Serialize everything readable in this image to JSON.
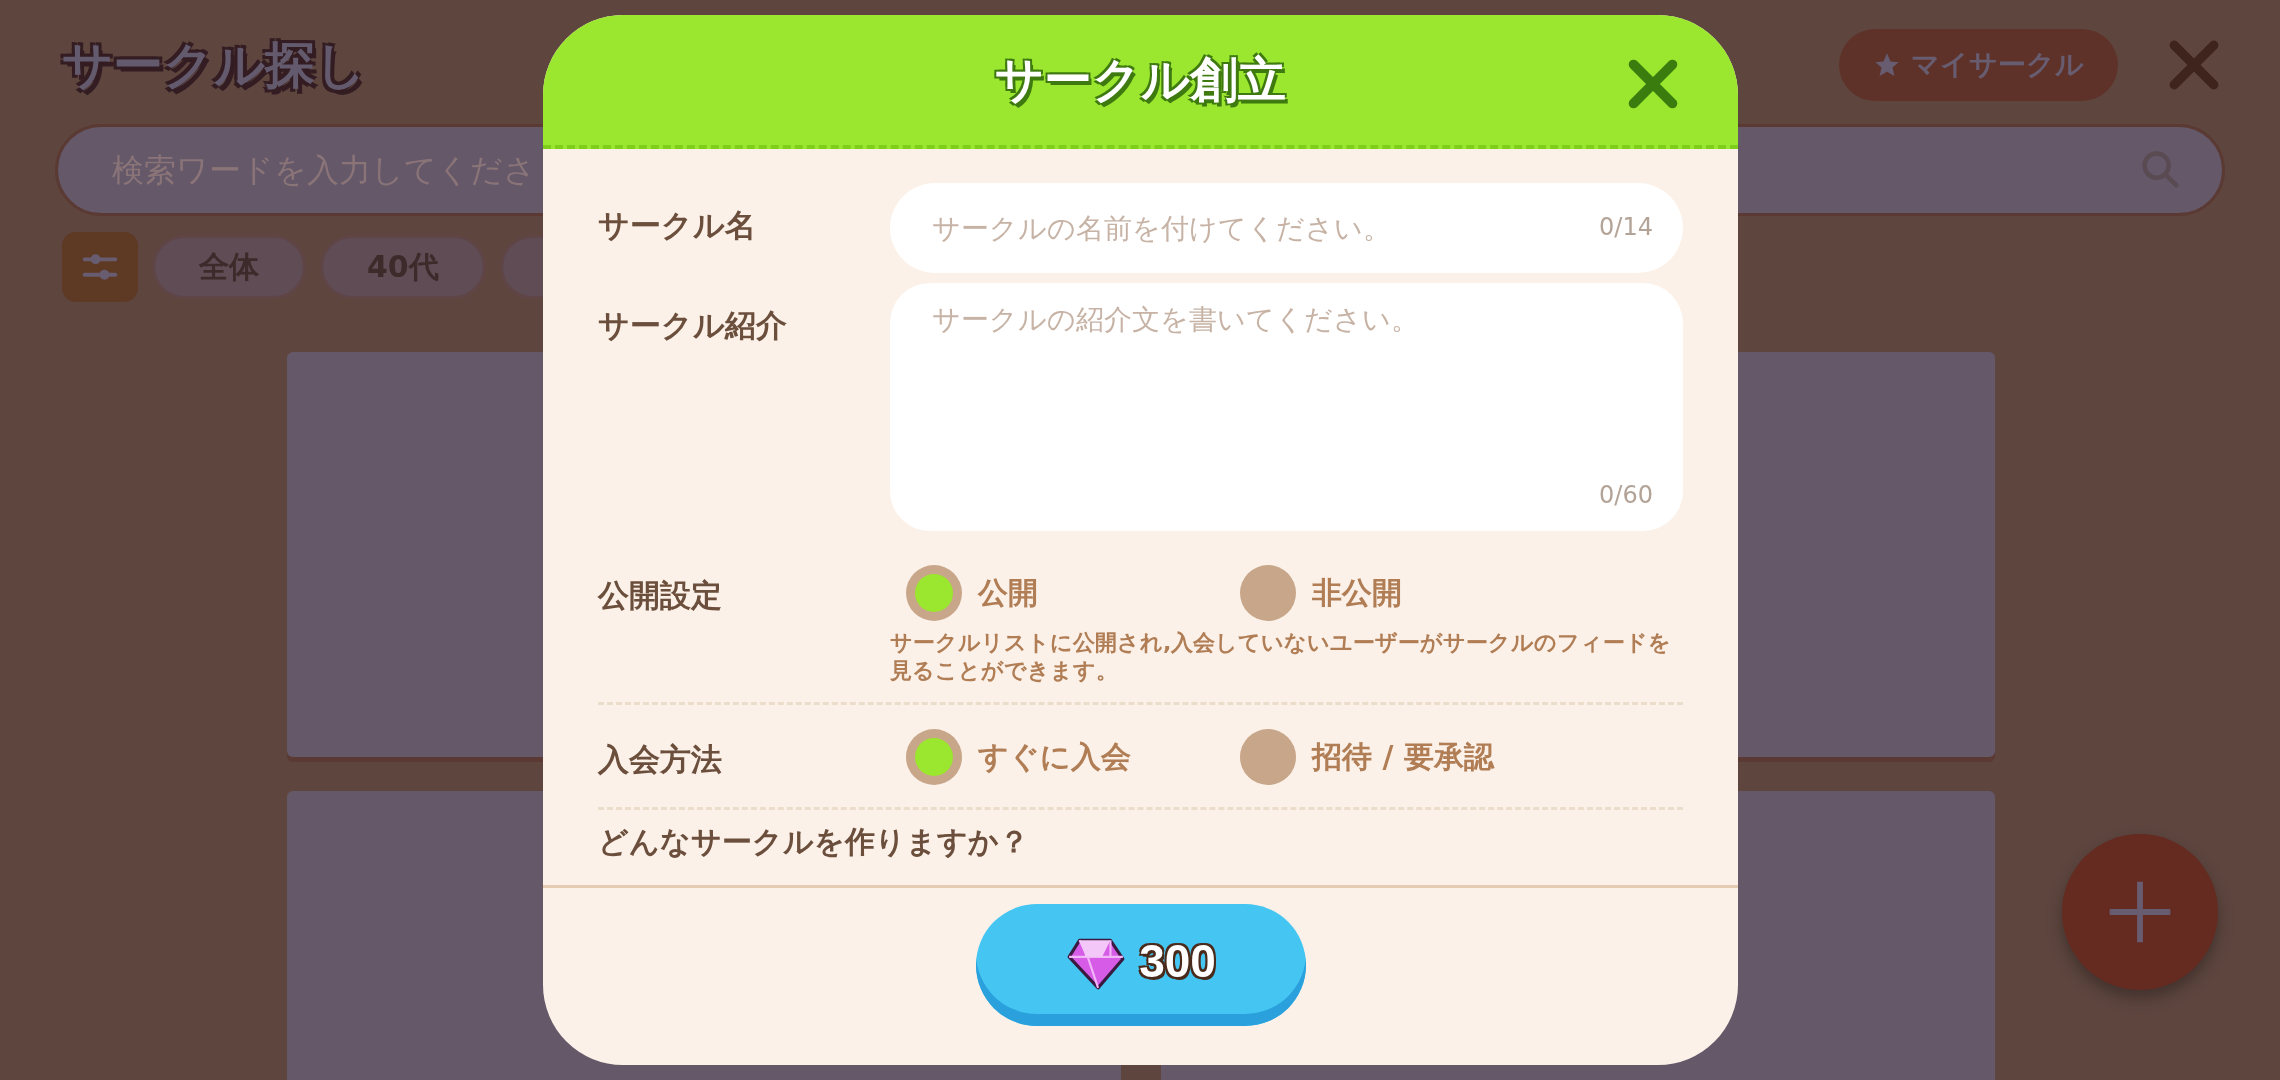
{
  "page": {
    "title": "サークル探し",
    "my_circle_button": "マイサークル",
    "search": {
      "placeholder": "検索ワードを入力してくださ"
    },
    "filter_chips": [
      {
        "label": "全体"
      },
      {
        "label": "40代"
      }
    ]
  },
  "dialog": {
    "title": "サークル創立",
    "fields": [
      {
        "kind": "single",
        "label": "サークル名",
        "placeholder": "サークルの名前を付けてください。",
        "counter": "0/14"
      },
      {
        "kind": "multi",
        "label": "サークル紹介",
        "placeholder": "サークルの紹介文を書いてください。",
        "counter": "0/60"
      }
    ],
    "options": [
      {
        "label": "公開設定",
        "choices": [
          {
            "label": "公開",
            "selected": true
          },
          {
            "label": "非公開",
            "selected": false
          }
        ],
        "note": "サークルリストに公開され,入会していないユーザーがサークルのフィードを見ることができます。"
      },
      {
        "label": "入会方法",
        "choices": [
          {
            "label": "すぐに入会",
            "selected": true
          },
          {
            "label": "招待 / 要承認",
            "selected": false
          }
        ]
      }
    ],
    "section_heading": "どんなサークルを作りますか？",
    "cost_button": {
      "amount": "300"
    }
  }
}
